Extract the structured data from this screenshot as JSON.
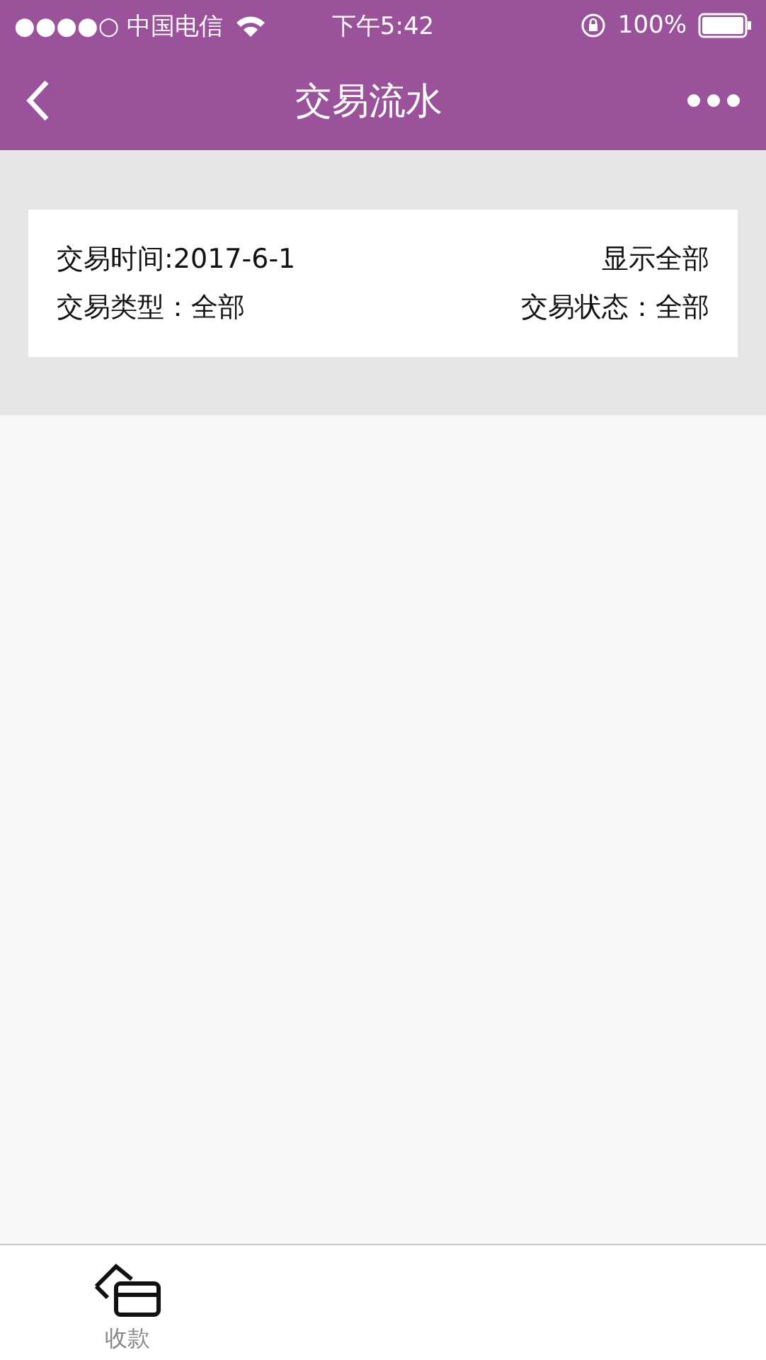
{
  "status_bar": {
    "carrier": "●●●●○ 中国电信",
    "time": "下午5:42",
    "battery": "100%"
  },
  "nav": {
    "title": "交易流水"
  },
  "filter": {
    "time": "交易时间:2017-6-1",
    "show_all": "显示全部",
    "type": "交易类型：全部",
    "status": "交易状态：全部"
  },
  "tab_bar": [
    {
      "label": "收款",
      "kind": "cards"
    }
  ]
}
